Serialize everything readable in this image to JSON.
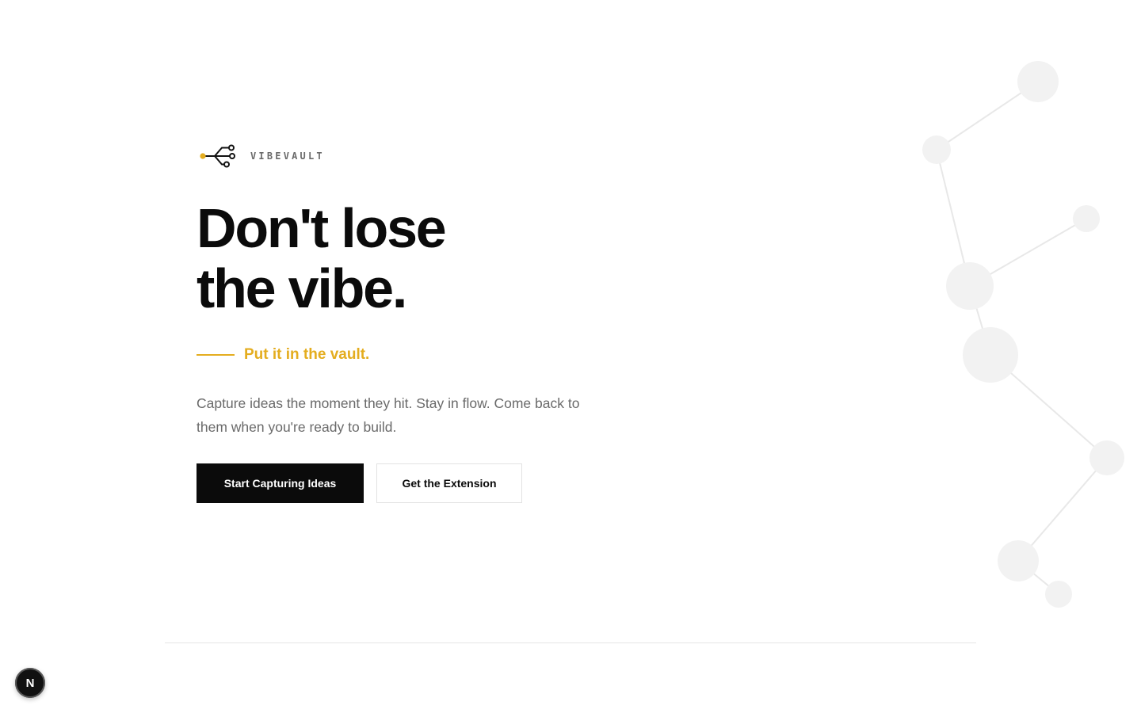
{
  "brand": {
    "name": "VIBEVAULT",
    "logo_icon": "branching-nodes-icon",
    "accent": "#e4ad1f"
  },
  "hero": {
    "headline_line1": "Don't lose",
    "headline_line2": "the vibe.",
    "tagline": "Put it in the vault.",
    "description": "Capture ideas the moment they hit. Stay in flow. Come back to them when you're ready to build."
  },
  "actions": {
    "primary_label": "Start Capturing Ideas",
    "secondary_label": "Get the Extension"
  },
  "dev_indicator": {
    "label": "N"
  },
  "colors": {
    "text": "#0b0b0b",
    "muted": "#6a6a6a",
    "accent": "#e4ad1f",
    "decor": "#f1f1f1",
    "decor_line": "#e8e8e8"
  }
}
